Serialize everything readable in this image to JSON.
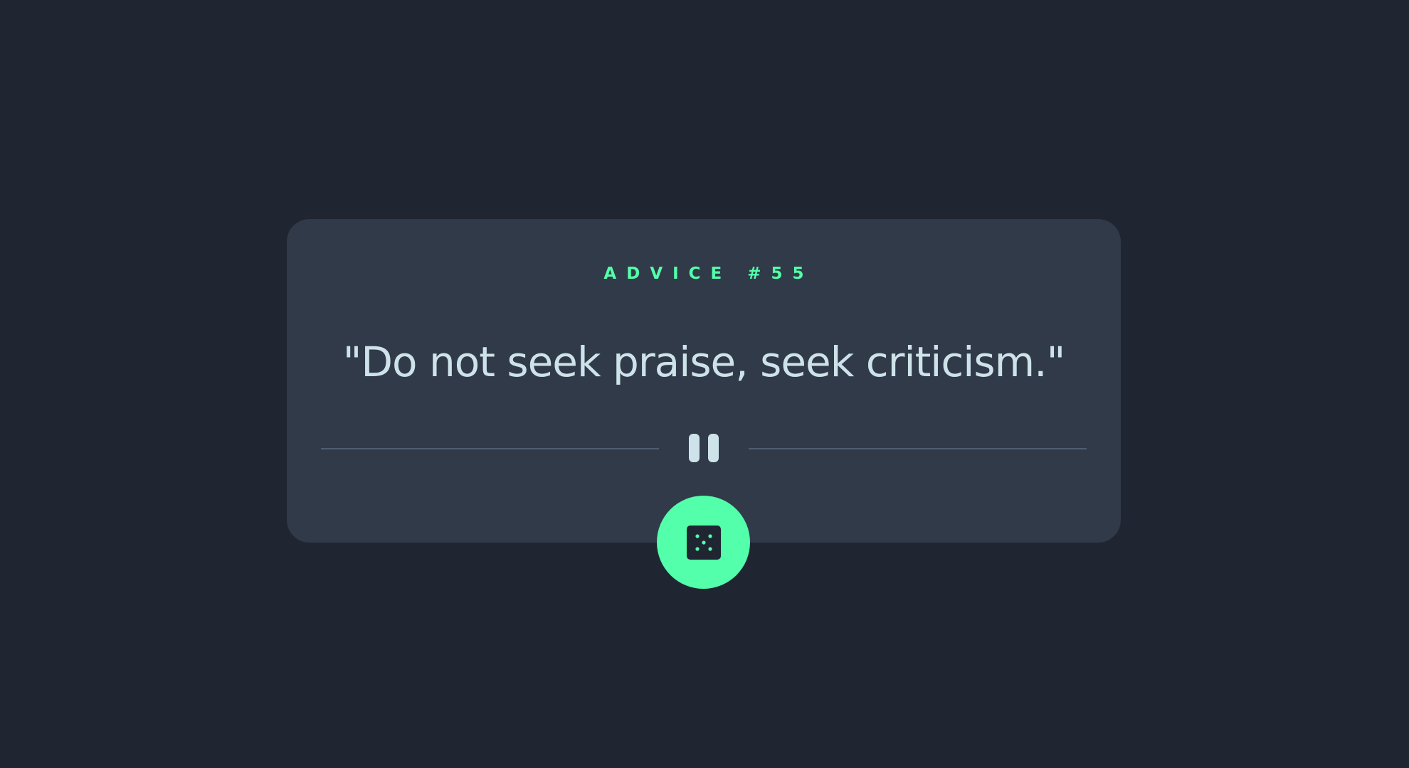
{
  "advice": {
    "label": "ADVICE #55",
    "text": "\"Do not seek praise, seek criticism.\""
  },
  "icons": {
    "divider": "pause-icon",
    "button": "dice-icon"
  },
  "colors": {
    "background": "#1f2632",
    "card": "#313a49",
    "accent": "#53ffaa",
    "text": "#cee3e9",
    "divider": "#4e5d73"
  }
}
